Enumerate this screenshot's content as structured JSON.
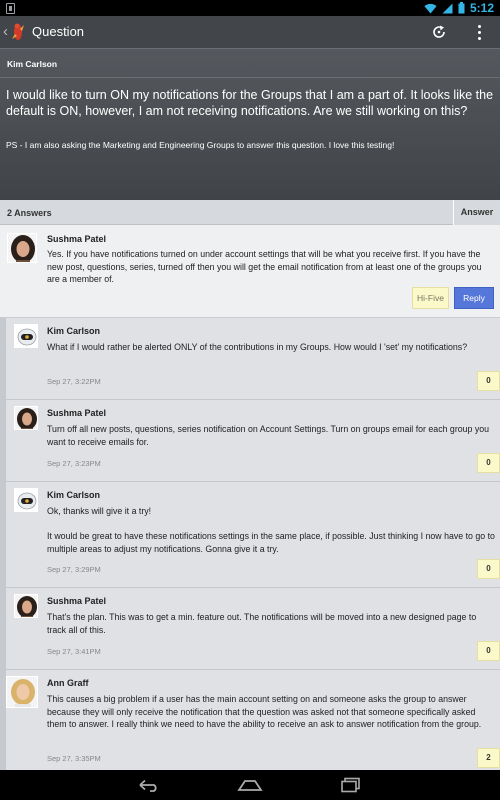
{
  "status_bar": {
    "time": "5:12"
  },
  "action_bar": {
    "title": "Question"
  },
  "question": {
    "author": "Kim Carlson",
    "text": "I would like to turn ON my notifications for the Groups that I am a part of.  It looks like the default is ON, however, I am not receiving notifications.  Are we still working on this?",
    "ps": "PS - I am also asking the Marketing and Engineering Groups to answer this question.  I love this testing!"
  },
  "answers_header": {
    "count_label": "2 Answers",
    "answer_button": "Answer"
  },
  "answer": {
    "author": "Sushma Patel",
    "text": "Yes.  If you have notifications turned on under account settings that will be what you receive first.  If you have the new post, questions, series, turned off then you will get the email notification from at least one of the groups you are a member of.",
    "hifive_label": "Hi-Five",
    "reply_label": "Reply"
  },
  "comments": [
    {
      "author": "Kim Carlson",
      "avatar": "robot-avatar",
      "text": "What if I would rather be alerted ONLY of the contributions in my Groups.  How would I 'set' my notifications?",
      "time": "Sep 27, 3:22PM",
      "count": "0"
    },
    {
      "author": "Sushma Patel",
      "avatar": "woman-dark-hair-avatar",
      "text": "Turn off all new posts, questions, series notification on Account Settings.  Turn on groups email for each group you want to receive emails for.",
      "time": "Sep 27, 3:23PM",
      "count": "0"
    },
    {
      "author": "Kim Carlson",
      "avatar": "robot-avatar",
      "text": "Ok, thanks will give it a try!\n\nIt would be great to have these notifications settings in the same place, if possible.  Just thinking I now have to go to multiple areas to adjust my notifications.  Gonna give it a try.",
      "time": "Sep 27, 3:29PM",
      "count": "0"
    },
    {
      "author": "Sushma Patel",
      "avatar": "woman-dark-hair-avatar",
      "text": "That's the plan.  This was to get a min. feature out.  The notifications will be moved into a new designed page to track all of this.",
      "time": "Sep 27, 3:41PM",
      "count": "0"
    },
    {
      "author": "Ann Graff",
      "avatar": "woman-blonde-avatar",
      "text": "This causes a big problem if a user has the main account setting on and someone asks the group to answer because they will only receive the notification that the question was asked not that someone specifically asked them to answer. I really think we need to have the ability to receive an ask to answer notification from the group.",
      "time": "Sep 27, 3:35PM",
      "count": "2"
    }
  ],
  "colors": {
    "accent": "#33b5e5",
    "reply_button": "#5577d9",
    "badge": "#fbf8c9"
  }
}
